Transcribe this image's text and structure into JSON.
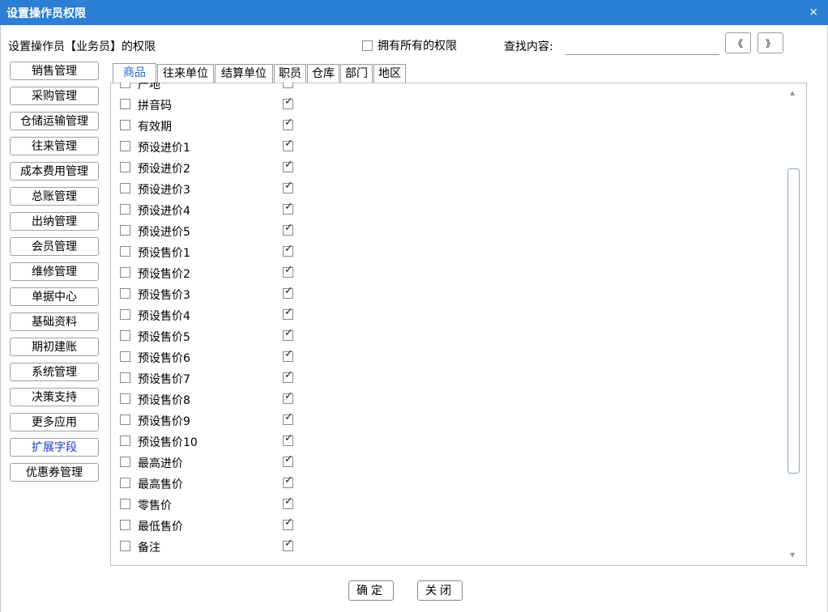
{
  "window": {
    "title": "设置操作员权限",
    "close_glyph": "×"
  },
  "header": {
    "text": "设置操作员【业务员】的权限",
    "all_perm_label": "拥有所有的权限",
    "find_label": "查找内容:",
    "find_value": "",
    "prev_label": "《",
    "next_label": "》"
  },
  "categories": [
    {
      "label": "销售管理"
    },
    {
      "label": "采购管理"
    },
    {
      "label": "仓储运输管理"
    },
    {
      "label": "往来管理"
    },
    {
      "label": "成本费用管理"
    },
    {
      "label": "总账管理"
    },
    {
      "label": "出纳管理"
    },
    {
      "label": "会员管理"
    },
    {
      "label": "维修管理"
    },
    {
      "label": "单据中心"
    },
    {
      "label": "基础资料"
    },
    {
      "label": "期初建账"
    },
    {
      "label": "系统管理"
    },
    {
      "label": "决策支持"
    },
    {
      "label": "更多应用"
    },
    {
      "label": "扩展字段",
      "active": true
    },
    {
      "label": "优惠券管理"
    }
  ],
  "tabs": [
    {
      "label": "商品",
      "active": true
    },
    {
      "label": "往来单位"
    },
    {
      "label": "结算单位"
    },
    {
      "label": "职员"
    },
    {
      "label": "仓库"
    },
    {
      "label": "部门"
    },
    {
      "label": "地区"
    }
  ],
  "rows": [
    {
      "label": "产地",
      "left_checked": false,
      "right_checked": true
    },
    {
      "label": "拼音码",
      "left_checked": false,
      "right_checked": true
    },
    {
      "label": "有效期",
      "left_checked": false,
      "right_checked": true
    },
    {
      "label": "预设进价1",
      "left_checked": false,
      "right_checked": true
    },
    {
      "label": "预设进价2",
      "left_checked": false,
      "right_checked": true
    },
    {
      "label": "预设进价3",
      "left_checked": false,
      "right_checked": true
    },
    {
      "label": "预设进价4",
      "left_checked": false,
      "right_checked": true
    },
    {
      "label": "预设进价5",
      "left_checked": false,
      "right_checked": true
    },
    {
      "label": "预设售价1",
      "left_checked": false,
      "right_checked": true
    },
    {
      "label": "预设售价2",
      "left_checked": false,
      "right_checked": true
    },
    {
      "label": "预设售价3",
      "left_checked": false,
      "right_checked": true
    },
    {
      "label": "预设售价4",
      "left_checked": false,
      "right_checked": true
    },
    {
      "label": "预设售价5",
      "left_checked": false,
      "right_checked": true
    },
    {
      "label": "预设售价6",
      "left_checked": false,
      "right_checked": true
    },
    {
      "label": "预设售价7",
      "left_checked": false,
      "right_checked": true
    },
    {
      "label": "预设售价8",
      "left_checked": false,
      "right_checked": true
    },
    {
      "label": "预设售价9",
      "left_checked": false,
      "right_checked": true
    },
    {
      "label": "预设售价10",
      "left_checked": false,
      "right_checked": true
    },
    {
      "label": "最高进价",
      "left_checked": false,
      "right_checked": true
    },
    {
      "label": "最高售价",
      "left_checked": false,
      "right_checked": true
    },
    {
      "label": "零售价",
      "left_checked": false,
      "right_checked": true
    },
    {
      "label": "最低售价",
      "left_checked": false,
      "right_checked": true
    },
    {
      "label": "备注",
      "left_checked": false,
      "right_checked": true
    }
  ],
  "check_glyph": "✓",
  "footer": {
    "ok_label": "确定",
    "close_label": "关闭"
  }
}
